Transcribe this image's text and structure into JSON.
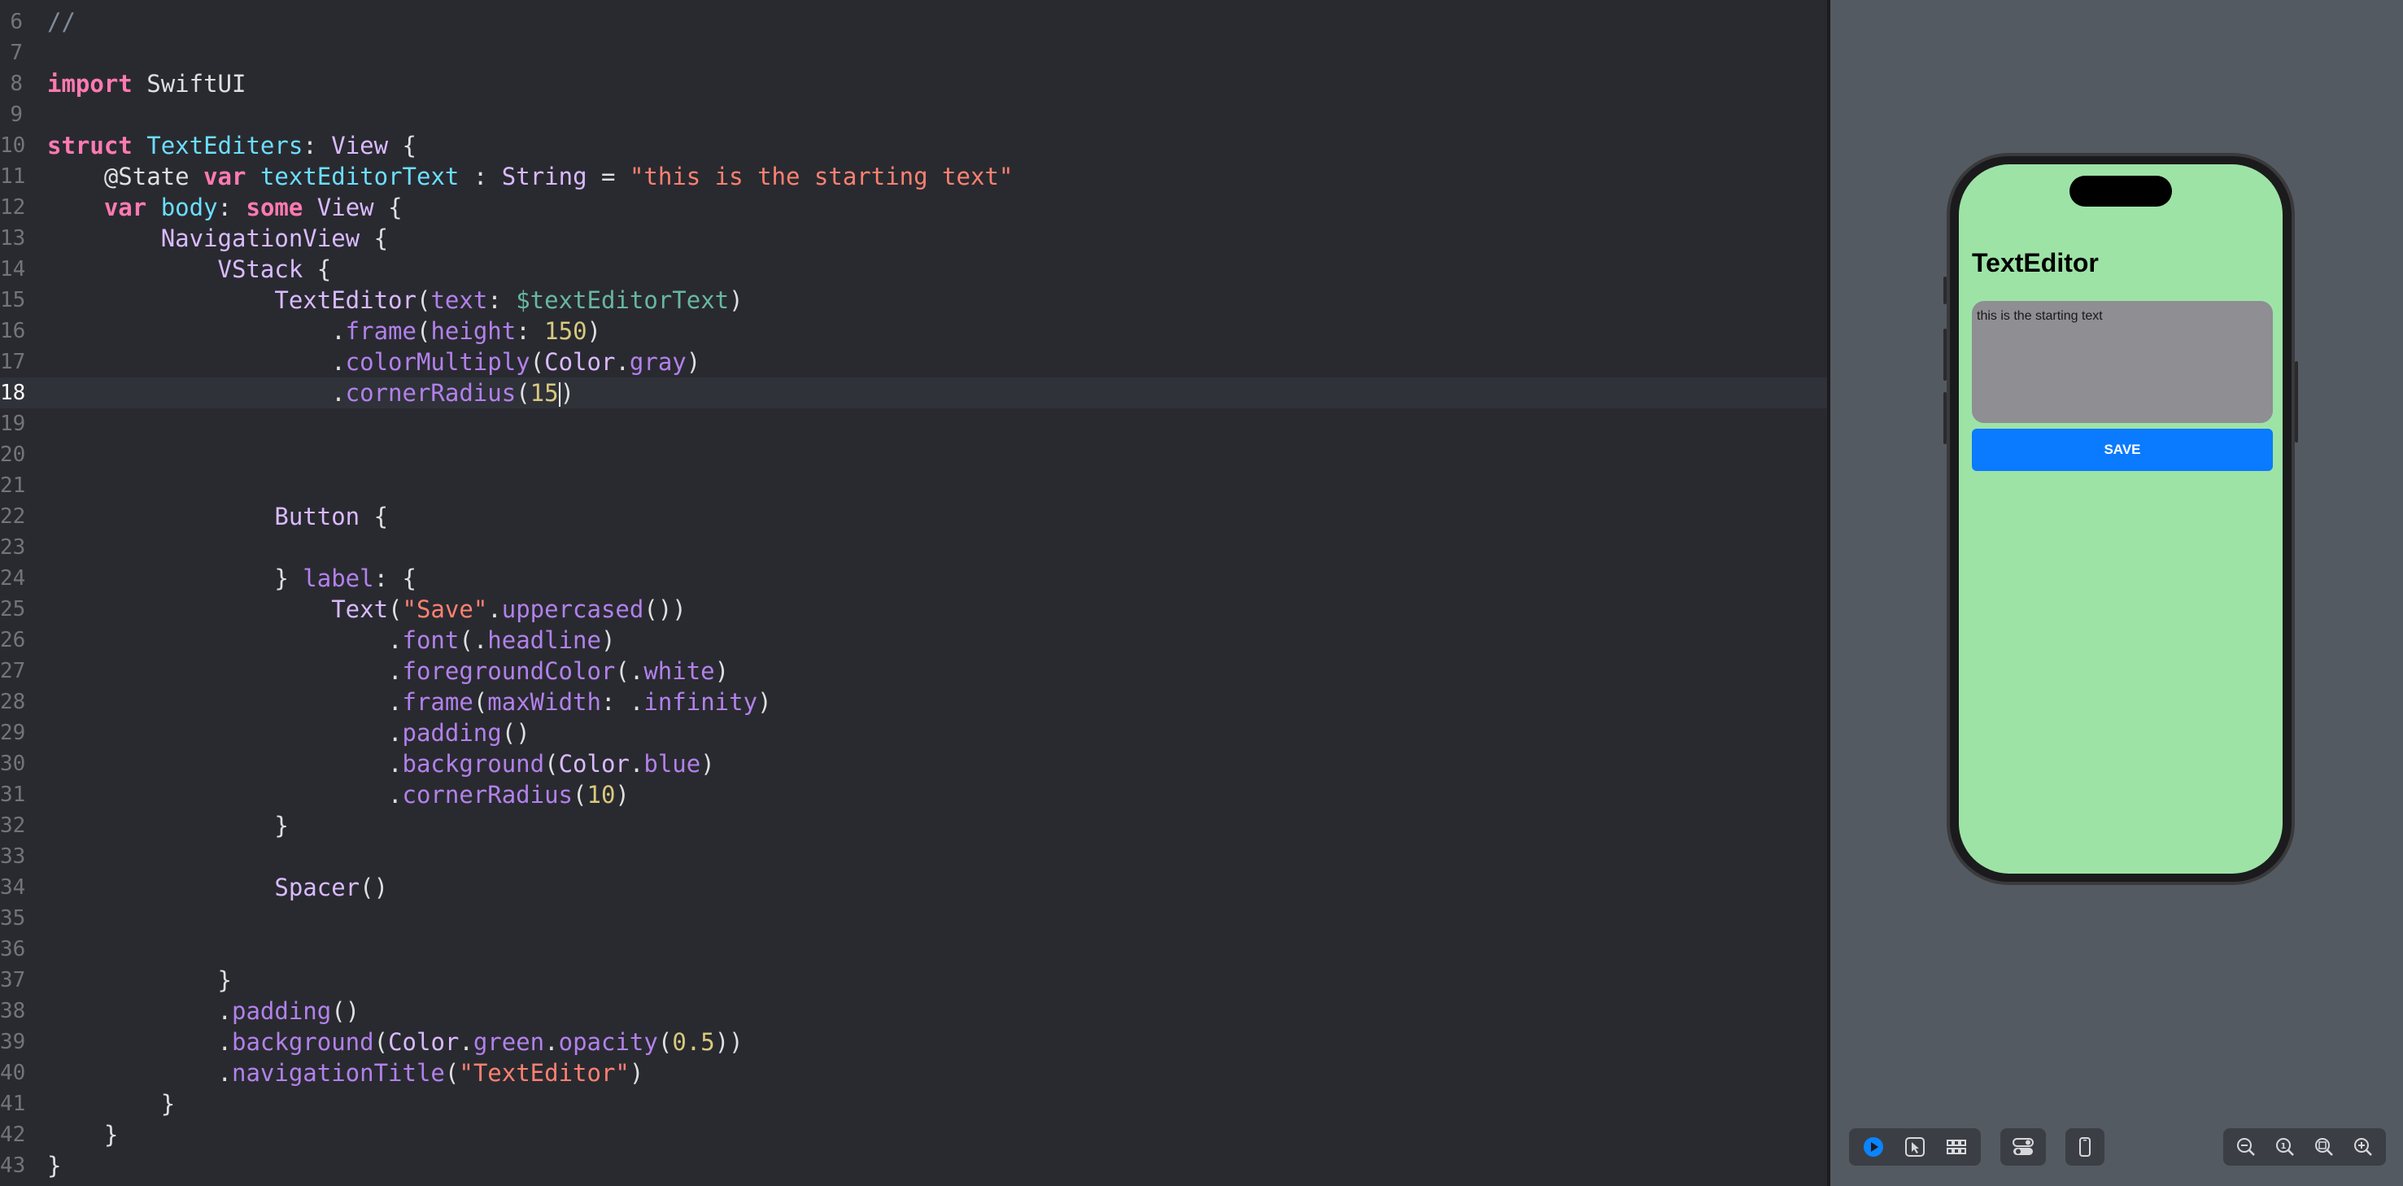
{
  "editor": {
    "current_line": 18,
    "lines": [
      {
        "num": "6",
        "text": "//"
      },
      {
        "num": "7",
        "text": ""
      },
      {
        "num": "8",
        "text": "import SwiftUI"
      },
      {
        "num": "9",
        "text": ""
      },
      {
        "num": "10",
        "text": "struct TextEditers: View {"
      },
      {
        "num": "11",
        "text": "    @State var textEditorText : String = \"this is the starting text\""
      },
      {
        "num": "12",
        "text": "    var body: some View {"
      },
      {
        "num": "13",
        "text": "        NavigationView {"
      },
      {
        "num": "14",
        "text": "            VStack {"
      },
      {
        "num": "15",
        "text": "                TextEditor(text: $textEditorText)"
      },
      {
        "num": "16",
        "text": "                    .frame(height: 150)"
      },
      {
        "num": "17",
        "text": "                    .colorMultiply(Color.gray)"
      },
      {
        "num": "18",
        "text": "                    .cornerRadius(15)"
      },
      {
        "num": "19",
        "text": ""
      },
      {
        "num": "20",
        "text": ""
      },
      {
        "num": "21",
        "text": ""
      },
      {
        "num": "22",
        "text": "                Button {"
      },
      {
        "num": "23",
        "text": ""
      },
      {
        "num": "24",
        "text": "                } label: {"
      },
      {
        "num": "25",
        "text": "                    Text(\"Save\".uppercased())"
      },
      {
        "num": "26",
        "text": "                        .font(.headline)"
      },
      {
        "num": "27",
        "text": "                        .foregroundColor(.white)"
      },
      {
        "num": "28",
        "text": "                        .frame(maxWidth: .infinity)"
      },
      {
        "num": "29",
        "text": "                        .padding()"
      },
      {
        "num": "30",
        "text": "                        .background(Color.blue)"
      },
      {
        "num": "31",
        "text": "                        .cornerRadius(10)"
      },
      {
        "num": "32",
        "text": "                }"
      },
      {
        "num": "33",
        "text": ""
      },
      {
        "num": "34",
        "text": "                Spacer()"
      },
      {
        "num": "35",
        "text": ""
      },
      {
        "num": "36",
        "text": ""
      },
      {
        "num": "37",
        "text": "            }"
      },
      {
        "num": "38",
        "text": "            .padding()"
      },
      {
        "num": "39",
        "text": "            .background(Color.green.opacity(0.5))"
      },
      {
        "num": "40",
        "text": "            .navigationTitle(\"TextEditor\")"
      },
      {
        "num": "41",
        "text": "        }"
      },
      {
        "num": "42",
        "text": "    }"
      },
      {
        "num": "43",
        "text": "}"
      }
    ]
  },
  "preview": {
    "nav_title": "TextEditor",
    "texteditor_text": "this is the starting text",
    "save_button_label": "SAVE",
    "screen_color": "#9de3a6",
    "editor_bg": "#8e8e93",
    "button_color": "#0a7aff"
  },
  "toolbar": {
    "groups": [
      {
        "name": "preview-mode",
        "icons": [
          "live-preview-icon",
          "selectable-icon",
          "variants-grid-icon"
        ]
      },
      {
        "name": "settings",
        "icons": [
          "canvas-settings-icon"
        ]
      },
      {
        "name": "device",
        "icons": [
          "device-icon"
        ]
      },
      {
        "name": "zoom",
        "icons": [
          "zoom-out-icon",
          "zoom-actual-icon",
          "zoom-fit-icon",
          "zoom-in-icon"
        ]
      }
    ]
  },
  "colors": {
    "editor_background": "#292a30",
    "keyword": "#ff7ab2",
    "string": "#ff8170",
    "number": "#d9c97c",
    "type": "#dabaff",
    "declaration": "#6bdfff",
    "method": "#b281eb",
    "canvas_background": "#545a62"
  }
}
